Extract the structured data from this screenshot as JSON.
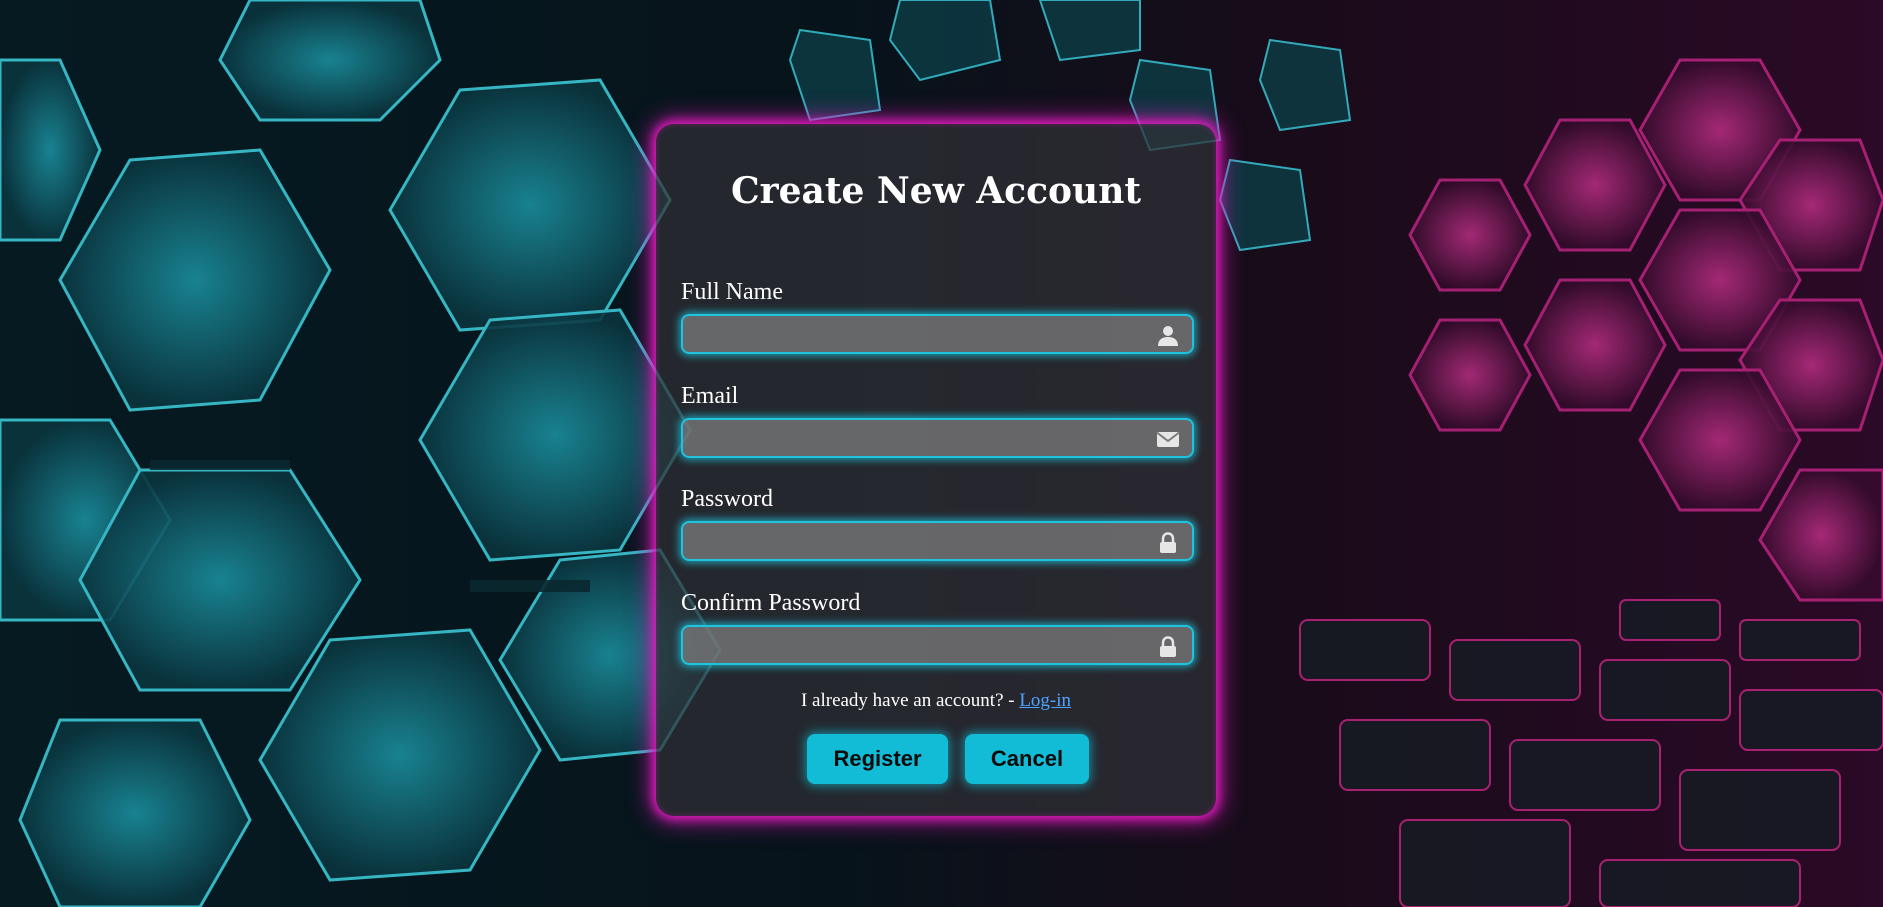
{
  "colors": {
    "card_glow": "#e21ac0",
    "field_glow": "#1ec4dd",
    "button_bg": "#12bcd6",
    "link": "#4ea3ff"
  },
  "form": {
    "title": "Create New Account",
    "fields": [
      {
        "label": "Full Name",
        "value": "",
        "placeholder": "",
        "icon": "user-icon"
      },
      {
        "label": "Email",
        "value": "",
        "placeholder": "",
        "icon": "envelope-icon"
      },
      {
        "label": "Password",
        "value": "",
        "placeholder": "",
        "icon": "lock-icon"
      },
      {
        "label": "Confirm Password",
        "value": "",
        "placeholder": "",
        "icon": "lock-icon"
      }
    ],
    "login_prompt": "I already have an account? - ",
    "login_link": "Log-in",
    "register_label": "Register",
    "cancel_label": "Cancel"
  }
}
